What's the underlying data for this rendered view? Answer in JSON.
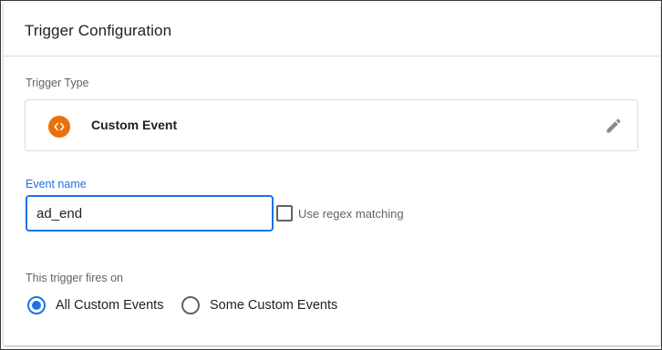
{
  "panel": {
    "title": "Trigger Configuration"
  },
  "trigger_type": {
    "section_label": "Trigger Type",
    "name": "Custom Event",
    "icon": "code-brackets-icon",
    "icon_glyph": "‹›",
    "icon_color": "#e8710a"
  },
  "event_name": {
    "label": "Event name",
    "value": "ad_end",
    "accent_color": "#1a73e8"
  },
  "regex": {
    "label": "Use regex matching",
    "checked": false
  },
  "fires_on": {
    "section_label": "This trigger fires on",
    "options": [
      {
        "label": "All Custom Events",
        "selected": true
      },
      {
        "label": "Some Custom Events",
        "selected": false
      }
    ]
  }
}
